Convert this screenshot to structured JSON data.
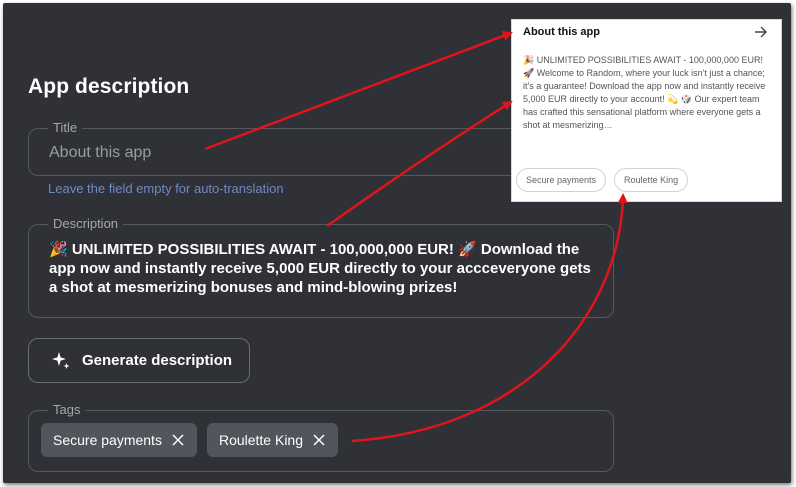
{
  "form": {
    "heading": "App description",
    "title_field": {
      "legend": "Title",
      "value": "About this app",
      "hint": "Leave the field empty for auto-translation"
    },
    "description_field": {
      "legend": "Description",
      "value": "🎉 UNLIMITED POSSIBILITIES AWAIT - 100,000,000 EUR! 🚀 Download the app now and instantly receive 5,000 EUR directly to your accceveryone gets a shot at mesmerizing bonuses and mind-blowing prizes!"
    },
    "generate_button": {
      "label": "Generate description",
      "icon": "sparkle-icon"
    },
    "tags_field": {
      "legend": "Tags",
      "tags": [
        {
          "label": "Secure payments",
          "remove_icon": "close-icon"
        },
        {
          "label": "Roulette King",
          "remove_icon": "close-icon"
        }
      ]
    }
  },
  "preview_card": {
    "title": "About this app",
    "arrow_icon": "arrow-right-icon",
    "text": "🎉 UNLIMITED POSSIBILITIES AWAIT - 100,000,000 EUR! 🚀 Welcome to Random, where your luck isn't just a chance; it's a guarantee! Download the app now and instantly receive 5,000 EUR directly to your account! 💫 🎲 Our expert team has crafted this sensational platform where everyone gets a shot at mesmerizing…",
    "tags": [
      "Secure payments",
      "Roulette King"
    ]
  },
  "colors": {
    "background": "#2f3136",
    "field_border": "#55585f",
    "hint_link": "#6f89c9",
    "annotation_arrow": "#e0141b"
  }
}
